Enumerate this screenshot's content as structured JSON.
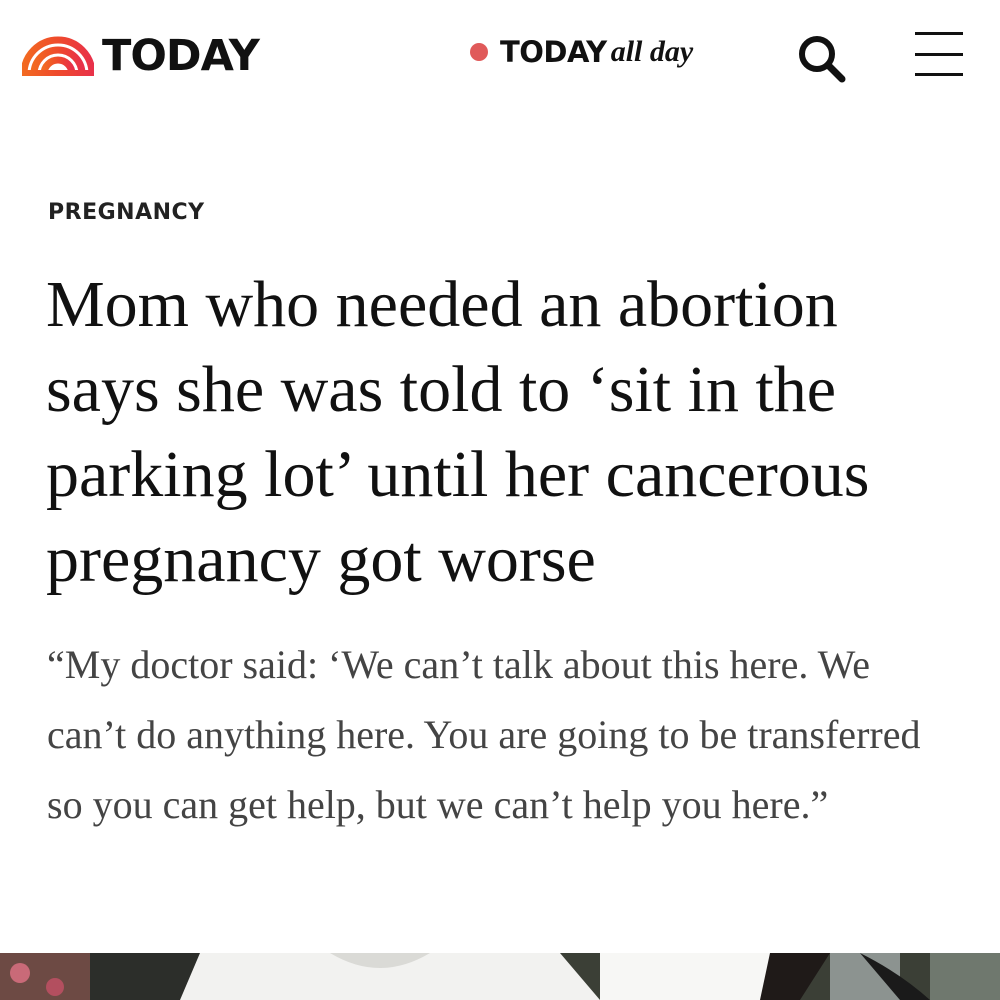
{
  "header": {
    "logo_text": "TODAY",
    "allday": {
      "brand": "TODAY",
      "sub": "all day"
    },
    "icons": {
      "logo": "rainbow-logo-icon",
      "live": "live-dot-icon",
      "search": "search-icon",
      "menu": "hamburger-menu-icon"
    }
  },
  "article": {
    "kicker": "PREGNANCY",
    "headline": "Mom who needed an abortion says she was told to ‘sit in the parking lot’ until her cancerous pregnancy got worse",
    "dek": "“My doctor said: ‘We can’t talk about this here. We can’t do anything here. You are going to be transferred so you can get help, but we can’t help you here.”"
  },
  "colors": {
    "brand_orange": "#f04e23",
    "live_dot": "#e05a5a",
    "text_dark": "#111111",
    "text_dek": "#444444"
  }
}
